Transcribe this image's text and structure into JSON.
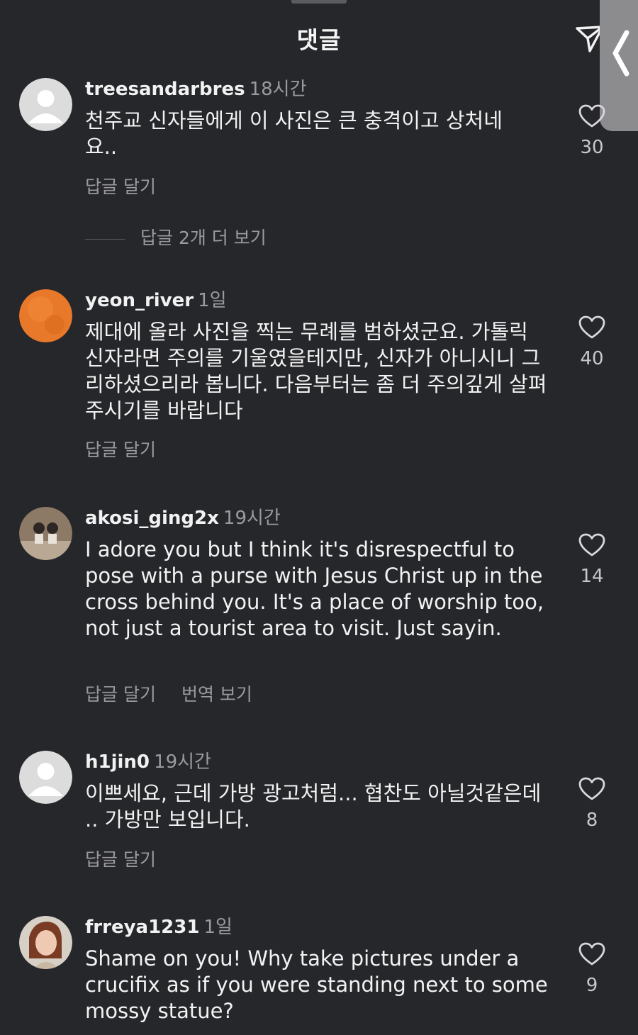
{
  "header": {
    "title": "댓글"
  },
  "view_more_replies": "답글 2개 더 보기",
  "comments": [
    {
      "username": "treesandarbres",
      "time": "18시간",
      "text": "천주교 신자들에게 이 사진은 큰 충격이고 상처네요..",
      "reply_label": "답글 달기",
      "likes": "30"
    },
    {
      "username": "yeon_river",
      "time": "1일",
      "text": "제대에 올라 사진을 찍는 무례를 범하셨군요. 가톨릭 신자라면 주의를 기울였을테지만, 신자가 아니시니 그리하셨으리라 봅니다. 다음부터는 좀 더 주의깊게 살펴주시기를 바랍니다",
      "reply_label": "답글 달기",
      "likes": "40"
    },
    {
      "username": "akosi_ging2x",
      "time": "19시간",
      "text": "I adore you but I think it's disrespectful to pose with a purse with Jesus Christ up in the cross behind you. It's a place of worship too, not just a tourist area to visit. Just sayin.",
      "reply_label": "답글 달기",
      "translate_label": "번역 보기",
      "likes": "14"
    },
    {
      "username": "h1jin0",
      "time": "19시간",
      "text": "이쁘세요, 근데 가방 광고처럼... 협찬도 아닐것같은데 .. 가방만 보입니다.",
      "reply_label": "답글 달기",
      "likes": "8"
    },
    {
      "username": "frreya1231",
      "time": "1일",
      "text": "Shame on you! Why take pictures under a crucifix as if you were standing next to some mossy statue?",
      "likes": "9"
    }
  ]
}
